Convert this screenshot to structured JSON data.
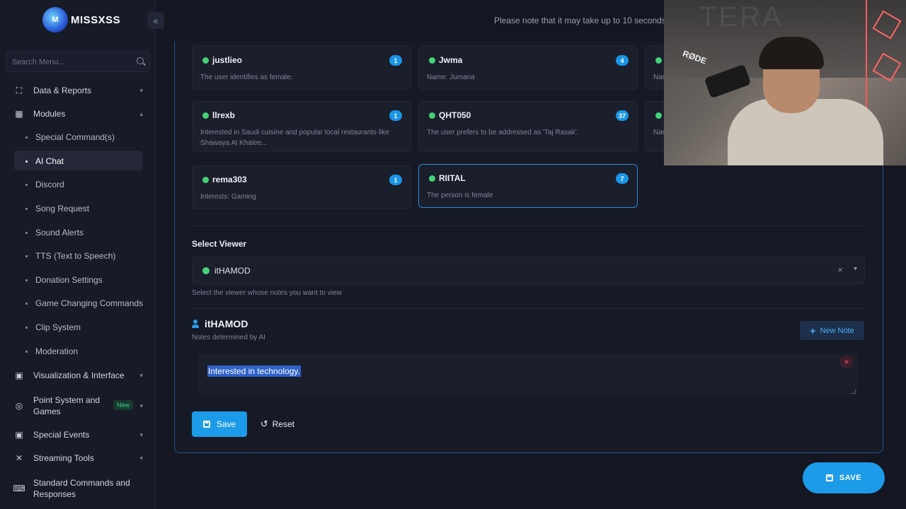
{
  "brand": {
    "name": "MISSXSS",
    "logo_initial": "M"
  },
  "header": {
    "notice": "Please note that it may take up to 10 seconds fo"
  },
  "sidebar": {
    "search_placeholder": "Search Menu...",
    "sections": [
      {
        "label": "Data & Reports",
        "icon": "expand-icon"
      },
      {
        "label": "Modules",
        "icon": "grid-icon"
      },
      {
        "label": "Visualization & Interface",
        "icon": "calendar-icon"
      },
      {
        "label": "Point System and Games",
        "icon": "coins-icon",
        "badge": "New"
      },
      {
        "label": "Special Events",
        "icon": "calendar-icon"
      },
      {
        "label": "Streaming Tools",
        "icon": "tools-icon"
      },
      {
        "label": "Standard Commands and Responses",
        "icon": "keyboard-icon"
      }
    ],
    "module_items": [
      "Special Command(s)",
      "AI Chat",
      "Discord",
      "Song Request",
      "Sound Alerts",
      "TTS (Text to Speech)",
      "Donation Settings",
      "Game Changing Commands",
      "Clip System",
      "Moderation"
    ]
  },
  "viewers": [
    {
      "name": "justlieo",
      "count": "1",
      "note": "The user identifies as female."
    },
    {
      "name": "Jwma",
      "count": "4",
      "note": "Name: Jumana"
    },
    {
      "name": "",
      "count": "",
      "note": "Nar"
    },
    {
      "name": "llrexb",
      "count": "1",
      "note": "Interested in Saudi cuisine and popular local restaurants like Shawaya Al Khalee..."
    },
    {
      "name": "QHT050",
      "count": "37",
      "note": "The user prefers to be addressed as 'Taj Rasak'."
    },
    {
      "name": "",
      "count": "",
      "note": "Nar"
    },
    {
      "name": "rema303",
      "count": "1",
      "note": "Interests: Gaming"
    },
    {
      "name": "RIITAL",
      "count": "7",
      "note": "The person is female"
    }
  ],
  "select_viewer": {
    "label": "Select Viewer",
    "value": "itHAMOD",
    "clear": "×",
    "help": "Select the viewer whose notes you want to view"
  },
  "notes": {
    "viewer": "itHAMOD",
    "subtitle": "Notes determined by AI",
    "new_note": "New Note",
    "items": [
      "Interested in technology."
    ]
  },
  "actions": {
    "save": "Save",
    "reset": "Reset",
    "big_save": "SAVE"
  },
  "webcam": {
    "mic_brand": "RØDE",
    "wall_text": "TERA"
  },
  "colors": {
    "accent": "#1c9be8",
    "online": "#45d17a",
    "danger": "#ff4d6d",
    "panel_border": "#1e5a8a"
  }
}
